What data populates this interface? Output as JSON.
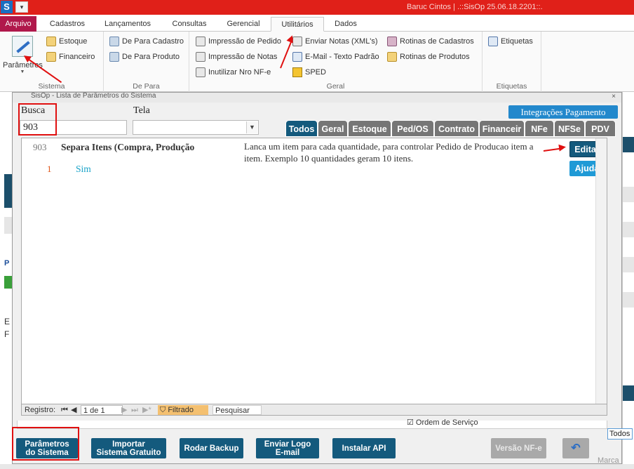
{
  "titlebar": {
    "title": "Baruc Cintos | .::SisOp 25.06.18.2201::.",
    "app_icon": "S",
    "quick_access": "▾"
  },
  "ribbon_tabs": [
    "Arquivo",
    "Cadastros",
    "Lançamentos",
    "Consultas",
    "Gerencial",
    "Utilitários",
    "Dados"
  ],
  "ribbon": {
    "sistema": {
      "big_button": "Parâmetros",
      "items": [
        "Estoque",
        "Financeiro"
      ],
      "group_label": "Sistema"
    },
    "depara": {
      "items": [
        "De Para Cadastro",
        "De Para Produto"
      ],
      "group_label": "De Para"
    },
    "geral": {
      "items_col1": [
        "Impressão de Pedido",
        "Impressão de Notas",
        "Inutilizar Nro NF-e"
      ],
      "items_col2": [
        "Enviar Notas (XML's)",
        "E-Mail - Texto Padrão",
        "SPED"
      ],
      "items_col3": [
        "Rotinas de Cadastros",
        "Rotinas de Produtos"
      ],
      "group_label": "Geral"
    },
    "etiquetas": {
      "items": [
        "Etiquetas"
      ],
      "group_label": "Etiquetas"
    }
  },
  "dialog": {
    "title": "SisOp - Lista de Parâmetros do Sistema",
    "close": "×",
    "busca_label": "Busca",
    "busca_value": "903",
    "tela_label": "Tela",
    "tela_value": "",
    "integracoes_button": "Integrações Pagamento",
    "filter_tabs": [
      "Todos",
      "Geral",
      "Estoque",
      "Ped/OS",
      "Contrato",
      "Financeir",
      "NFe",
      "NFSe",
      "PDV"
    ],
    "parameter": {
      "code": "903",
      "name": "Separa Itens (Compra, Produção",
      "description": "Lanca um item para cada quantidade, para controlar Pedido de Producao item a item. Exemplo 10 quantidades geram 10 itens.",
      "value_index": "1",
      "value": "Sim"
    },
    "edit_button": "Editar",
    "help_button": "Ajuda",
    "pager": {
      "registro_label": "Registro:",
      "position": "1 de 1",
      "filtered": "Filtrado",
      "search": "Pesquisar"
    }
  },
  "bottom_buttons": [
    {
      "line1": "Parâmetros",
      "line2": "do Sistema",
      "enabled": true
    },
    {
      "line1": "Importar",
      "line2": "Sistema Gratuito",
      "enabled": true
    },
    {
      "line1": "Rodar Backup",
      "line2": "",
      "enabled": true
    },
    {
      "line1": "Enviar Logo",
      "line2": "E-mail",
      "enabled": true
    },
    {
      "line1": "Instalar API",
      "line2": "",
      "enabled": true
    },
    {
      "line1": "Versão NF-e",
      "line2": "",
      "enabled": false
    }
  ],
  "background_app": {
    "ordem_servico": "Ordem de Serviço",
    "todos_tab": "Todos",
    "marca_label": "Marca"
  },
  "colors": {
    "title_red": "#e02019",
    "arquivo_magenta": "#b0184b",
    "active_tab": "#145a7d",
    "inactive_tab": "#767676",
    "annotation_red": "#e01010"
  }
}
